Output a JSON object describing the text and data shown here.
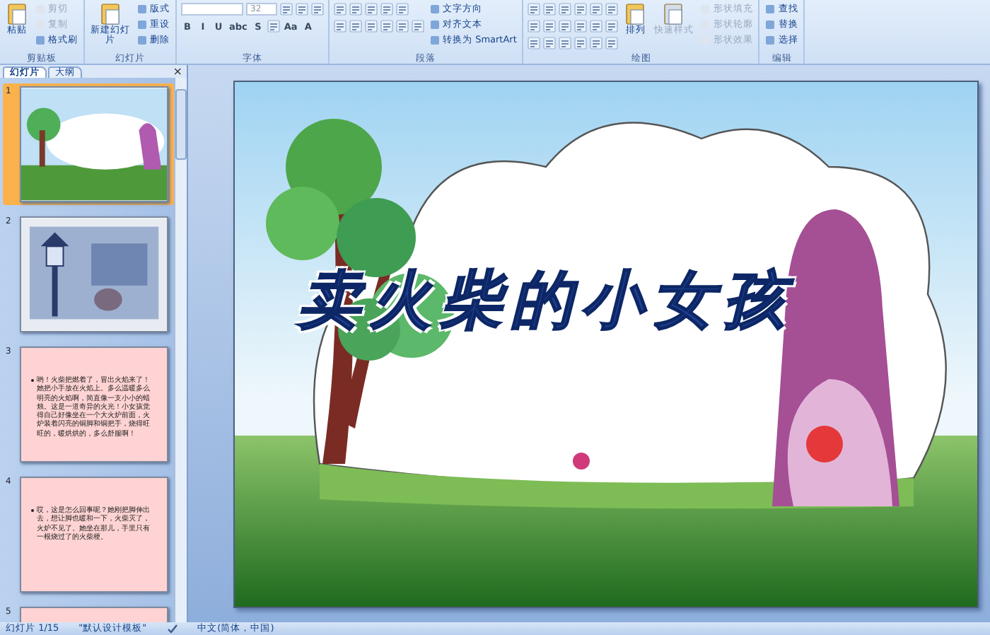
{
  "ribbon": {
    "groups": [
      {
        "label": "剪贴板",
        "columns": [
          {
            "kind": "large",
            "label": "粘贴",
            "disabled": false
          },
          {
            "kind": "stack",
            "items": [
              {
                "label": "剪切",
                "disabled": true
              },
              {
                "label": "复制",
                "disabled": true
              },
              {
                "label": "格式刷",
                "disabled": false
              }
            ]
          }
        ]
      },
      {
        "label": "幻灯片",
        "columns": [
          {
            "kind": "large",
            "label": "新建幻灯片",
            "disabled": false
          },
          {
            "kind": "stack",
            "items": [
              {
                "label": "版式",
                "disabled": false
              },
              {
                "label": "重设",
                "disabled": false
              },
              {
                "label": "删除",
                "disabled": false
              }
            ]
          }
        ]
      },
      {
        "label": "字体",
        "columns": [
          {
            "kind": "rows",
            "toolbars": [
              {
                "controls": [
                  {
                    "kind": "field"
                  },
                  {
                    "kind": "field",
                    "label": "32"
                  },
                  {
                    "kind": "icon"
                  },
                  {
                    "kind": "icon"
                  },
                  {
                    "kind": "icon"
                  }
                ]
              },
              {
                "controls": [
                  {
                    "kind": "glyph",
                    "label": "B"
                  },
                  {
                    "kind": "glyph",
                    "label": "I"
                  },
                  {
                    "kind": "glyph",
                    "label": "U"
                  },
                  {
                    "kind": "glyph",
                    "label": "abc"
                  },
                  {
                    "kind": "glyph",
                    "label": "S"
                  },
                  {
                    "kind": "icon"
                  },
                  {
                    "kind": "glyph",
                    "label": "Aa"
                  },
                  {
                    "kind": "glyph",
                    "label": "A"
                  }
                ]
              }
            ]
          }
        ]
      },
      {
        "label": "段落",
        "columns": [
          {
            "kind": "rows",
            "toolbars": [
              {
                "controls": [
                  {
                    "kind": "icon"
                  },
                  {
                    "kind": "icon"
                  },
                  {
                    "kind": "icon"
                  },
                  {
                    "kind": "icon"
                  },
                  {
                    "kind": "icon"
                  }
                ]
              },
              {
                "controls": [
                  {
                    "kind": "icon"
                  },
                  {
                    "kind": "icon"
                  },
                  {
                    "kind": "icon"
                  },
                  {
                    "kind": "icon"
                  },
                  {
                    "kind": "icon"
                  },
                  {
                    "kind": "icon"
                  }
                ]
              }
            ]
          },
          {
            "kind": "stack",
            "items": [
              {
                "label": "文字方向",
                "disabled": false
              },
              {
                "label": "对齐文本",
                "disabled": false
              },
              {
                "label": "转换为 SmartArt",
                "disabled": false
              }
            ]
          }
        ]
      },
      {
        "label": "绘图",
        "columns": [
          {
            "kind": "rows",
            "toolbars": [
              {
                "controls": [
                  {
                    "kind": "icon"
                  },
                  {
                    "kind": "icon"
                  },
                  {
                    "kind": "icon"
                  },
                  {
                    "kind": "icon"
                  },
                  {
                    "kind": "icon"
                  },
                  {
                    "kind": "icon"
                  }
                ]
              },
              {
                "controls": [
                  {
                    "kind": "icon"
                  },
                  {
                    "kind": "icon"
                  },
                  {
                    "kind": "icon"
                  },
                  {
                    "kind": "icon"
                  },
                  {
                    "kind": "icon"
                  },
                  {
                    "kind": "icon"
                  }
                ]
              },
              {
                "controls": [
                  {
                    "kind": "icon"
                  },
                  {
                    "kind": "icon"
                  },
                  {
                    "kind": "icon"
                  },
                  {
                    "kind": "icon"
                  },
                  {
                    "kind": "icon"
                  },
                  {
                    "kind": "icon"
                  }
                ]
              }
            ]
          },
          {
            "kind": "large",
            "label": "排列",
            "disabled": false
          },
          {
            "kind": "large",
            "label": "快速样式",
            "disabled": true
          },
          {
            "kind": "stack",
            "items": [
              {
                "label": "形状填充",
                "disabled": true
              },
              {
                "label": "形状轮廓",
                "disabled": true
              },
              {
                "label": "形状效果",
                "disabled": true
              }
            ]
          }
        ]
      },
      {
        "label": "编辑",
        "columns": [
          {
            "kind": "stack",
            "items": [
              {
                "label": "查找",
                "disabled": false
              },
              {
                "label": "替换",
                "disabled": false
              },
              {
                "label": "选择",
                "disabled": false
              }
            ]
          }
        ]
      }
    ]
  },
  "panel": {
    "tabs": [
      {
        "label": "幻灯片",
        "selected": true
      },
      {
        "label": "大纲",
        "selected": false
      }
    ],
    "close": "×",
    "slides": [
      {
        "number": "1",
        "kind": "picture",
        "selected": true
      },
      {
        "number": "2",
        "kind": "picture",
        "selected": false
      },
      {
        "number": "3",
        "kind": "text",
        "selected": false,
        "text": "哟！火柴把燃着了，冒出火焰来了！她把小手放在火焰上。多么温暖多么明亮的火焰啊，简直像一支小小的蜡烛。这是一道奇异的火光！小女孩觉得自己好像坐在一个大火炉前面，火炉装着闪亮的铜脚和铜把手，烧得旺旺的，暖烘烘的，多么舒服啊！"
      },
      {
        "number": "4",
        "kind": "text",
        "selected": false,
        "text": "哎，这是怎么回事呢？她刚把脚伸出去，想让脚也暖和一下，火柴灭了，火炉不见了。她坐在那儿，手里只有一根烧过了的火柴梗。"
      },
      {
        "number": "5",
        "kind": "blank",
        "selected": false
      }
    ]
  },
  "slide": {
    "title": "卖火柴的小女孩"
  },
  "status_bar": {
    "slide": "幻灯片 1/15",
    "theme": "\"默认设计模板\"",
    "language": "中文(简体，中国)"
  }
}
